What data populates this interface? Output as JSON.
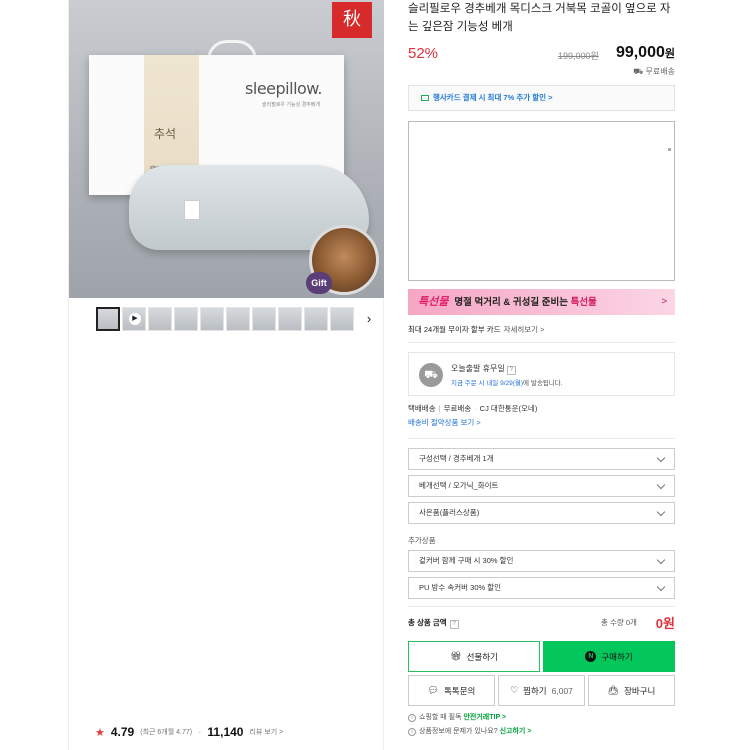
{
  "product": {
    "title": "슬리필로우 경추베개 목디스크 거북목 코골이 옆으로 자는 깊은잠 기능성 베개",
    "discount": "52%",
    "original_price": "199,000원",
    "price": "99,000",
    "price_unit": "원",
    "shipping": "무료배송"
  },
  "image": {
    "brand_text": "sleepillow.",
    "brand_sub": "슬리필로우 기능성 경추베개",
    "box_text": "추석",
    "box_sub": "sleep pillow",
    "seal_text": "秋",
    "gift_badge": "Gift",
    "thumbnail_count": 10
  },
  "card_promo": "행사카드 결제 시 최대 7% 추가 할인 >",
  "promo_banner": {
    "logo": "특선물",
    "text_before": "명절 먹거리 & 귀성길 준비는 ",
    "highlight": "특선물",
    "chevron": ">"
  },
  "installment": {
    "text": "최대 24개월 무이자 할부 카드",
    "more": "자세히보기 >"
  },
  "delivery": {
    "title": "오늘출발 휴무일",
    "help": "?",
    "sub_prefix": "지금 주문 시 내일 9/29(월)",
    "sub_suffix": "에 발송됩니다."
  },
  "carrier": {
    "method": "택배배송",
    "fee": "무료배송",
    "company": "CJ 대한통운(오네)",
    "fee_link": "배송비 절약상품 보기 >"
  },
  "options": [
    {
      "label": "구성선택 / 경추베개 1개"
    },
    {
      "label": "베개선택 / 오가닉_화이트"
    },
    {
      "label": "사은품(플러스상품)"
    }
  ],
  "addons_label": "추가상품",
  "addons": [
    {
      "label": "겉커버 함께 구매 시 30% 할인"
    },
    {
      "label": "PU 방수 속커버 30% 할인"
    }
  ],
  "total": {
    "label": "총 상품 금액",
    "help": "?",
    "qty": "총 수량 0개",
    "price": "0원"
  },
  "buttons": {
    "gift": "선물하기",
    "buy": "구매하기",
    "buy_badge": "N",
    "talk": "톡톡문의",
    "wish": "찜하기",
    "wish_count": "6,007",
    "cart": "장바구니"
  },
  "notices": [
    {
      "text": "쇼핑할 때 필독 ",
      "link": "안전거래TIP >"
    },
    {
      "text": "상품정보에 문제가 있나요? ",
      "link": "신고하기 >"
    }
  ],
  "review": {
    "score": "4.79",
    "recent": "(최근 6개월 4.77)",
    "count": "11,140",
    "more": "리뷰 보기 >"
  },
  "colors": {
    "accent_red": "#e0303d",
    "naver_green": "#03c75a",
    "link_blue": "#1f6fd6",
    "promo_pink": "#f6a6c3"
  }
}
